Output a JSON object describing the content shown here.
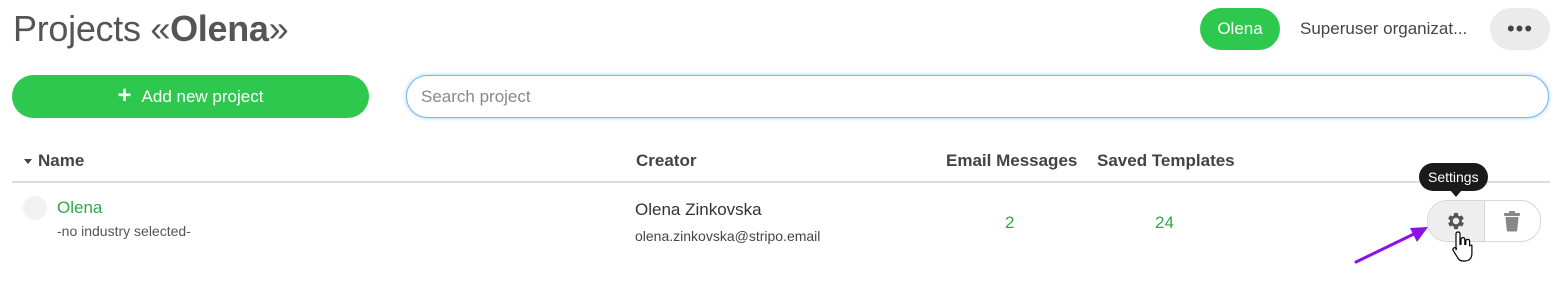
{
  "header": {
    "title_prefix": "Projects «",
    "title_org": "Olena",
    "title_suffix": "»",
    "user_pill": "Olena",
    "organization": "Superuser organizat...",
    "more_label": "•••"
  },
  "toolbar": {
    "add_label": "Add new project",
    "search_placeholder": "Search project",
    "search_value": ""
  },
  "table": {
    "columns": [
      "Name",
      "Creator",
      "Email Messages",
      "Saved Templates"
    ],
    "rows": [
      {
        "name": "Olena",
        "industry": "-no industry selected-",
        "creator_name": "Olena Zinkovska",
        "creator_email": "olena.zinkovska@stripo.email",
        "email_messages": "2",
        "saved_templates": "24"
      }
    ]
  },
  "tooltip": {
    "text": "Settings"
  },
  "icons": {
    "sort": "caret-down-icon",
    "add": "plus-icon",
    "settings": "gear-icon",
    "delete": "trash-icon",
    "more": "ellipsis-icon"
  },
  "colors": {
    "brand_green": "#2ec84f",
    "link_green": "#2ea84a",
    "search_border": "#7ab7e8",
    "annotation_purple": "#8a12e8"
  }
}
